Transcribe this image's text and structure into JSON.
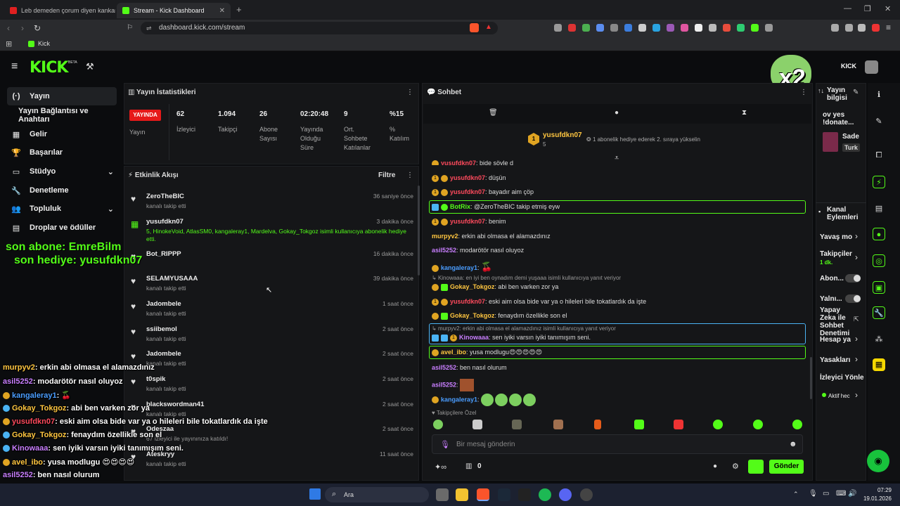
{
  "browser": {
    "tabs": [
      {
        "title": "Leb demeden çorum diyen kankamla",
        "active": false
      },
      {
        "title": "Stream - Kick Dashboard",
        "active": true
      }
    ],
    "url": "dashboard.kick.com/stream",
    "bookmark": "Kick"
  },
  "header": {
    "logo": "KICK",
    "logo_badge": "BETA",
    "avatar_label": "KICK",
    "overlay_multiplier": "x2"
  },
  "sidebar": {
    "items": [
      {
        "label": "Yayın",
        "icon": "(·)"
      },
      {
        "label": "Yayın Bağlantısı ve Anahtarı",
        "icon": ""
      },
      {
        "label": "Gelir",
        "icon": "▦"
      },
      {
        "label": "Başarılar",
        "icon": "🏆"
      },
      {
        "label": "Stüdyo",
        "icon": "▭"
      },
      {
        "label": "Denetleme",
        "icon": "🔧"
      },
      {
        "label": "Topluluk",
        "icon": "👥"
      },
      {
        "label": "Droplar ve ödüller",
        "icon": "▤"
      }
    ]
  },
  "stats": {
    "title": "Yayın İstatistikleri",
    "live_badge": "YAYINDA",
    "live_label": "Yayın",
    "items": [
      {
        "value": "62",
        "label": "İzleyici"
      },
      {
        "value": "1.094",
        "label": "Takipçi"
      },
      {
        "value": "26",
        "label": "Abone Sayısı"
      },
      {
        "value": "02:20:48",
        "label": "Yayında Olduğu Süre"
      },
      {
        "value": "9",
        "label": "Ort. Sohbete Katılanlar"
      },
      {
        "value": "%15",
        "label": "% Katılım"
      }
    ]
  },
  "activity": {
    "title": "Etkinlik Akışı",
    "filter": "Filtre",
    "events": [
      {
        "name": "ZeroTheBIC",
        "sub": "kanalı takip etti",
        "time": "36 saniye önce"
      },
      {
        "name": "yusufdkn07",
        "sub": "5, HinokeVoid, AtlasSM0, kangaleray1, Mardelva, Gokay_Tokgoz isimli kullanıcıya abonelik hediye etti.",
        "time": "3 dakika önce"
      },
      {
        "name": "Bot_RIPPP",
        "sub": "kanalı takip etti",
        "time": "16 dakika önce"
      },
      {
        "name": "SELAMYUSAAA",
        "sub": "kanalı takip etti",
        "time": "39 dakika önce"
      },
      {
        "name": "Jadombele",
        "sub": "kanalı takip etti",
        "time": "1 saat önce"
      },
      {
        "name": "ssiibemol",
        "sub": "kanalı takip etti",
        "time": "2 saat önce"
      },
      {
        "name": "Jadombele",
        "sub": "kanalı takip etti",
        "time": "2 saat önce"
      },
      {
        "name": "t0spik",
        "sub": "kanalı takip etti",
        "time": "2 saat önce"
      },
      {
        "name": "blackswordman41",
        "sub": "kanalı takip etti",
        "time": "2 saat önce"
      },
      {
        "name": "Odeszaa",
        "sub": "67 izleyici ile yayınınıza katıldı!",
        "time": "2 saat önce"
      },
      {
        "name": "Ateskryy",
        "sub": "kanalı takip etti",
        "time": "11 saat önce"
      }
    ]
  },
  "overlay": {
    "line1": "son abone: EmreBilm",
    "line2": "son hediye: yusufdkn07",
    "chat": [
      {
        "user": "murpyv2",
        "msg": ": erkin abi olmasa el alamazdınız"
      },
      {
        "user": "asil5252",
        "msg": ": modarötör nasıl oluyoz"
      },
      {
        "user": "kangaleray1",
        "msg": ":"
      },
      {
        "user": "Gokay_Tokgoz",
        "msg": ": abi ben varken zor ya"
      },
      {
        "user": "yusufdkn07",
        "msg": ": eski aim olsa bide var ya o hileleri bile tokatlardık da işte"
      },
      {
        "user": "Gokay_Tokgoz",
        "msg": ": fenaydım özellikle son el"
      },
      {
        "user": "Kinowaaa",
        "msg": ": sen iyiki varsın iyiki tanımışım seni."
      },
      {
        "user": "avel_ibo",
        "msg": ": yusa modlugu"
      },
      {
        "user": "asil5252",
        "msg": ": ben nasıl olurum"
      },
      {
        "user": "asil5252",
        "msg": ":"
      },
      {
        "user": "kangaleray1",
        "msg": ":"
      }
    ]
  },
  "chat": {
    "title": "Sohbet",
    "gifter": "yusufdkn07",
    "gifter_count": "5",
    "gift_cta": "1 abonelik hediye ederek 2. sıraya yükselin",
    "messages": [
      {
        "user": "yusufdkn07",
        "msg": ": bide şöyle d"
      },
      {
        "user": "yusufdkn07",
        "msg": ": düşün"
      },
      {
        "user": "yusufdkn07",
        "msg": ": bayadır aim çöp"
      },
      {
        "user": "BotRix",
        "msg": ": @ZeroTheBIC takip etmiş eyw"
      },
      {
        "user": "yusufdkn07",
        "msg": ": benim"
      },
      {
        "user": "murpyv2",
        "msg": ": erkin abi olmasa el alamazdınız"
      },
      {
        "user": "asil5252",
        "msg": ": modarötör nasıl oluyoz"
      },
      {
        "user": "kangaleray1",
        "msg": ":"
      },
      {
        "reply": "Kinowaaa: en iyi ben oynadım demi yuşaaa isimli kullanıcıya yanıt veriyor",
        "user": "Gokay_Tokgoz",
        "msg": ": abi ben varken zor ya"
      },
      {
        "user": "yusufdkn07",
        "msg": ": eski aim olsa bide var ya o hileleri bile tokatlardık da işte"
      },
      {
        "user": "Gokay_Tokgoz",
        "msg": ": fenaydım özellikle son el"
      },
      {
        "reply": "murpyv2: erkin abi olmasa el alamazdınız isimli kullanıcıya yanıt veriyor",
        "user": "Kinowaaa",
        "msg": ": sen iyiki varsın iyiki tanımışım seni."
      },
      {
        "user": "avel_ibo",
        "msg": ": yusa modlugu"
      },
      {
        "user": "asil5252",
        "msg": ": ben nasıl olurum"
      },
      {
        "user": "asil5252",
        "msg": ":"
      },
      {
        "user": "kangaleray1",
        "msg": ":"
      }
    ],
    "followers_only": "Takipçilere Özel",
    "input_placeholder": "Bir mesaj gönderin",
    "points": "0",
    "send": "Gönder"
  },
  "right_panel": {
    "stream_info": "Yayın bilgisi",
    "title_snip": "ov yes !donate...",
    "category": "Sade",
    "lang": "Turk",
    "channel_actions": "Kanal Eylemleri",
    "slow_mode": "Yavaş mo",
    "followers": "Takipçiler",
    "followers_sub": "1 dk.",
    "subs": "Abon...",
    "only": "Yalnı...",
    "ai": "Yapay Zeka ile Sohbet Denetimi",
    "account": "Hesap ya",
    "bans": "Yasakları",
    "viewer": "İzleyici Yönle",
    "active": "Aktif hec"
  },
  "taskbar": {
    "search": "Ara",
    "time": "07:29",
    "date": "19.01.2026"
  }
}
